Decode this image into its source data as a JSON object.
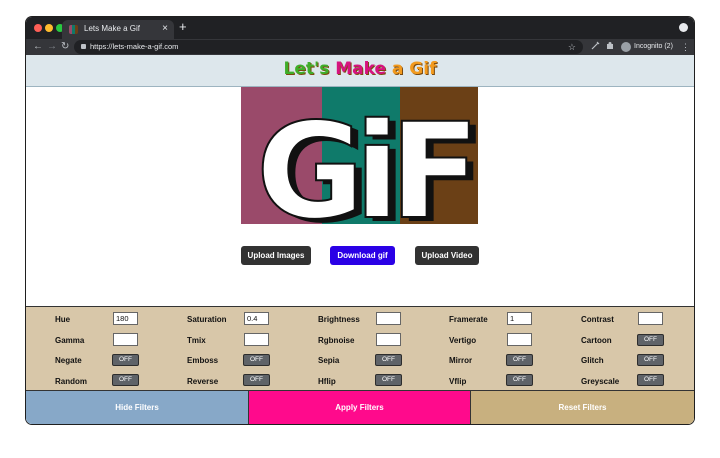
{
  "browser": {
    "tab_title": "Lets Make a Gif",
    "url": "https://lets-make-a-gif.com",
    "profile_label": "Incognito (2)",
    "close_glyph": "×",
    "new_tab_glyph": "+",
    "back_glyph": "←",
    "forward_glyph": "→",
    "reload_glyph": "↻",
    "bookmark_glyph": "☆",
    "menu_glyph": "⋮"
  },
  "header": {
    "title_parts": [
      "Let's",
      " Make",
      " a",
      " Gif"
    ],
    "title_colors": [
      "#3fae2a",
      "#d6137f",
      "#f29a1e",
      "#f29a1e"
    ],
    "background": "#dde7ec"
  },
  "gif_preview": {
    "text": "GiF",
    "panel_colors": [
      "#9a4a6a",
      "#0f7a6a",
      "#6b4016"
    ]
  },
  "actions": {
    "upload_images": "Upload Images",
    "download_gif": "Download gif",
    "upload_video": "Upload Video",
    "colors": {
      "dark": "#323232",
      "accent": "#2a00e6"
    }
  },
  "filters": {
    "rows": [
      [
        {
          "label": "Hue",
          "type": "input",
          "value": "180"
        },
        {
          "label": "Saturation",
          "type": "input",
          "value": "0.4"
        },
        {
          "label": "Brightness",
          "type": "input",
          "value": ""
        },
        {
          "label": "Framerate",
          "type": "input",
          "value": "1"
        },
        {
          "label": "Contrast",
          "type": "input",
          "value": ""
        }
      ],
      [
        {
          "label": "Gamma",
          "type": "input",
          "value": ""
        },
        {
          "label": "Tmix",
          "type": "input",
          "value": ""
        },
        {
          "label": "Rgbnoise",
          "type": "input",
          "value": ""
        },
        {
          "label": "Vertigo",
          "type": "input",
          "value": ""
        },
        {
          "label": "Cartoon",
          "type": "toggle",
          "value": "OFF"
        }
      ],
      [
        {
          "label": "Negate",
          "type": "toggle",
          "value": "OFF"
        },
        {
          "label": "Emboss",
          "type": "toggle",
          "value": "OFF"
        },
        {
          "label": "Sepia",
          "type": "toggle",
          "value": "OFF"
        },
        {
          "label": "Mirror",
          "type": "toggle",
          "value": "OFF"
        },
        {
          "label": "Glitch",
          "type": "toggle",
          "value": "OFF"
        }
      ],
      [
        {
          "label": "Random",
          "type": "toggle",
          "value": "OFF"
        },
        {
          "label": "Reverse",
          "type": "toggle",
          "value": "OFF"
        },
        {
          "label": "Hflip",
          "type": "toggle",
          "value": "OFF"
        },
        {
          "label": "Vflip",
          "type": "toggle",
          "value": "OFF"
        },
        {
          "label": "Greyscale",
          "type": "toggle",
          "value": "OFF"
        }
      ]
    ]
  },
  "footer": {
    "hide_filters": "Hide Filters",
    "apply_filters": "Apply Filters",
    "reset_filters": "Reset Filters",
    "colors": {
      "hide": "#87a8c8",
      "apply": "#ff0a8c",
      "reset": "#c8b07f"
    }
  }
}
